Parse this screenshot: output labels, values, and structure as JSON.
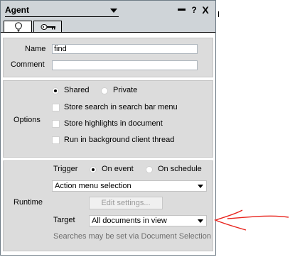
{
  "window": {
    "title": "Agent",
    "help_glyph": "?",
    "close_glyph": "X"
  },
  "tabs": [
    {
      "name": "basics",
      "icon": "lightbulb-icon",
      "active": true
    },
    {
      "name": "security",
      "icon": "key-icon",
      "active": false
    }
  ],
  "identity": {
    "name_label": "Name",
    "name_value": "find",
    "comment_label": "Comment",
    "comment_value": ""
  },
  "options": {
    "section_label": "Options",
    "shared_label": "Shared",
    "shared_selected": true,
    "private_label": "Private",
    "checkboxes": [
      {
        "label": "Store search in search bar menu",
        "checked": false
      },
      {
        "label": "Store highlights in document",
        "checked": false
      },
      {
        "label": "Run in background client thread",
        "checked": false
      }
    ]
  },
  "runtime": {
    "section_label": "Runtime",
    "trigger_label": "Trigger",
    "on_event_label": "On event",
    "on_event_selected": true,
    "on_schedule_label": "On schedule",
    "event_select_value": "Action menu selection",
    "edit_settings_label": "Edit settings...",
    "target_label": "Target",
    "target_select_value": "All documents in view",
    "hint": "Searches may be set via Document Selection"
  },
  "annotation": {
    "color": "#e8231c"
  }
}
